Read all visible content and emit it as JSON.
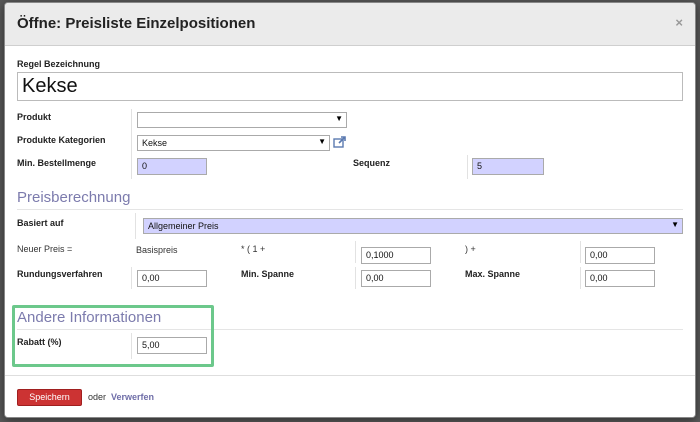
{
  "dialog": {
    "title": "Öffne: Preisliste Einzelpositionen",
    "close": "×"
  },
  "form": {
    "rule_name_label": "Regel Bezeichnung",
    "rule_name_value": "Kekse",
    "product_label": "Produkt",
    "product_value": "",
    "category_label": "Produkte Kategorien",
    "category_value": "Kekse",
    "min_qty_label": "Min. Bestellmenge",
    "min_qty_value": "0",
    "sequence_label": "Sequenz",
    "sequence_value": "5"
  },
  "price_calc": {
    "title": "Preisberechnung",
    "based_on_label": "Basiert auf",
    "based_on_value": "Allgemeiner Preis",
    "new_price_label": "Neuer Preis =",
    "base_price_text": "Basispreis",
    "times_text": "* ( 1 +",
    "discount_factor": "0,1000",
    "close_paren_text": ") +",
    "surcharge": "0,00",
    "rounding_label": "Rundungsverfahren",
    "rounding_value": "0,00",
    "min_margin_label": "Min. Spanne",
    "min_margin_value": "0,00",
    "max_margin_label": "Max. Spanne",
    "max_margin_value": "0,00"
  },
  "other_info": {
    "title": "Andere Informationen",
    "discount_label": "Rabatt (%)",
    "discount_value": "5,00"
  },
  "footer": {
    "save_label": "Speichern",
    "or_text": "oder",
    "discard_label": "Verwerfen"
  },
  "colors": {
    "required_bg": "#d2d2ff",
    "section_title": "#7c7bad",
    "save_button": "#cc3333",
    "highlight_border": "#6cc88b"
  }
}
